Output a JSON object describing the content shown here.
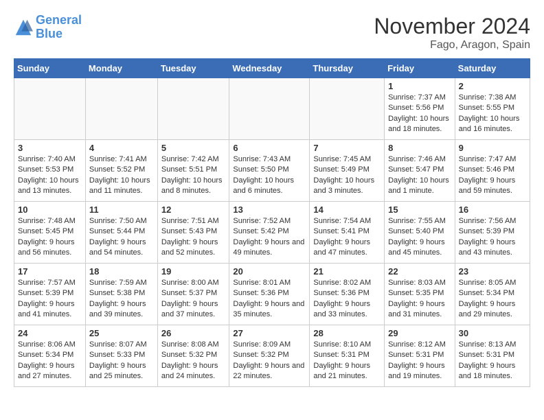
{
  "header": {
    "logo": {
      "line1": "General",
      "line2": "Blue"
    },
    "title": "November 2024",
    "location": "Fago, Aragon, Spain"
  },
  "weekdays": [
    "Sunday",
    "Monday",
    "Tuesday",
    "Wednesday",
    "Thursday",
    "Friday",
    "Saturday"
  ],
  "weeks": [
    [
      {
        "day": "",
        "empty": true
      },
      {
        "day": "",
        "empty": true
      },
      {
        "day": "",
        "empty": true
      },
      {
        "day": "",
        "empty": true
      },
      {
        "day": "",
        "empty": true
      },
      {
        "day": "1",
        "sunrise": "Sunrise: 7:37 AM",
        "sunset": "Sunset: 5:56 PM",
        "daylight": "Daylight: 10 hours and 18 minutes."
      },
      {
        "day": "2",
        "sunrise": "Sunrise: 7:38 AM",
        "sunset": "Sunset: 5:55 PM",
        "daylight": "Daylight: 10 hours and 16 minutes."
      }
    ],
    [
      {
        "day": "3",
        "sunrise": "Sunrise: 7:40 AM",
        "sunset": "Sunset: 5:53 PM",
        "daylight": "Daylight: 10 hours and 13 minutes."
      },
      {
        "day": "4",
        "sunrise": "Sunrise: 7:41 AM",
        "sunset": "Sunset: 5:52 PM",
        "daylight": "Daylight: 10 hours and 11 minutes."
      },
      {
        "day": "5",
        "sunrise": "Sunrise: 7:42 AM",
        "sunset": "Sunset: 5:51 PM",
        "daylight": "Daylight: 10 hours and 8 minutes."
      },
      {
        "day": "6",
        "sunrise": "Sunrise: 7:43 AM",
        "sunset": "Sunset: 5:50 PM",
        "daylight": "Daylight: 10 hours and 6 minutes."
      },
      {
        "day": "7",
        "sunrise": "Sunrise: 7:45 AM",
        "sunset": "Sunset: 5:49 PM",
        "daylight": "Daylight: 10 hours and 3 minutes."
      },
      {
        "day": "8",
        "sunrise": "Sunrise: 7:46 AM",
        "sunset": "Sunset: 5:47 PM",
        "daylight": "Daylight: 10 hours and 1 minute."
      },
      {
        "day": "9",
        "sunrise": "Sunrise: 7:47 AM",
        "sunset": "Sunset: 5:46 PM",
        "daylight": "Daylight: 9 hours and 59 minutes."
      }
    ],
    [
      {
        "day": "10",
        "sunrise": "Sunrise: 7:48 AM",
        "sunset": "Sunset: 5:45 PM",
        "daylight": "Daylight: 9 hours and 56 minutes."
      },
      {
        "day": "11",
        "sunrise": "Sunrise: 7:50 AM",
        "sunset": "Sunset: 5:44 PM",
        "daylight": "Daylight: 9 hours and 54 minutes."
      },
      {
        "day": "12",
        "sunrise": "Sunrise: 7:51 AM",
        "sunset": "Sunset: 5:43 PM",
        "daylight": "Daylight: 9 hours and 52 minutes."
      },
      {
        "day": "13",
        "sunrise": "Sunrise: 7:52 AM",
        "sunset": "Sunset: 5:42 PM",
        "daylight": "Daylight: 9 hours and 49 minutes."
      },
      {
        "day": "14",
        "sunrise": "Sunrise: 7:54 AM",
        "sunset": "Sunset: 5:41 PM",
        "daylight": "Daylight: 9 hours and 47 minutes."
      },
      {
        "day": "15",
        "sunrise": "Sunrise: 7:55 AM",
        "sunset": "Sunset: 5:40 PM",
        "daylight": "Daylight: 9 hours and 45 minutes."
      },
      {
        "day": "16",
        "sunrise": "Sunrise: 7:56 AM",
        "sunset": "Sunset: 5:39 PM",
        "daylight": "Daylight: 9 hours and 43 minutes."
      }
    ],
    [
      {
        "day": "17",
        "sunrise": "Sunrise: 7:57 AM",
        "sunset": "Sunset: 5:39 PM",
        "daylight": "Daylight: 9 hours and 41 minutes."
      },
      {
        "day": "18",
        "sunrise": "Sunrise: 7:59 AM",
        "sunset": "Sunset: 5:38 PM",
        "daylight": "Daylight: 9 hours and 39 minutes."
      },
      {
        "day": "19",
        "sunrise": "Sunrise: 8:00 AM",
        "sunset": "Sunset: 5:37 PM",
        "daylight": "Daylight: 9 hours and 37 minutes."
      },
      {
        "day": "20",
        "sunrise": "Sunrise: 8:01 AM",
        "sunset": "Sunset: 5:36 PM",
        "daylight": "Daylight: 9 hours and 35 minutes."
      },
      {
        "day": "21",
        "sunrise": "Sunrise: 8:02 AM",
        "sunset": "Sunset: 5:36 PM",
        "daylight": "Daylight: 9 hours and 33 minutes."
      },
      {
        "day": "22",
        "sunrise": "Sunrise: 8:03 AM",
        "sunset": "Sunset: 5:35 PM",
        "daylight": "Daylight: 9 hours and 31 minutes."
      },
      {
        "day": "23",
        "sunrise": "Sunrise: 8:05 AM",
        "sunset": "Sunset: 5:34 PM",
        "daylight": "Daylight: 9 hours and 29 minutes."
      }
    ],
    [
      {
        "day": "24",
        "sunrise": "Sunrise: 8:06 AM",
        "sunset": "Sunset: 5:34 PM",
        "daylight": "Daylight: 9 hours and 27 minutes."
      },
      {
        "day": "25",
        "sunrise": "Sunrise: 8:07 AM",
        "sunset": "Sunset: 5:33 PM",
        "daylight": "Daylight: 9 hours and 25 minutes."
      },
      {
        "day": "26",
        "sunrise": "Sunrise: 8:08 AM",
        "sunset": "Sunset: 5:32 PM",
        "daylight": "Daylight: 9 hours and 24 minutes."
      },
      {
        "day": "27",
        "sunrise": "Sunrise: 8:09 AM",
        "sunset": "Sunset: 5:32 PM",
        "daylight": "Daylight: 9 hours and 22 minutes."
      },
      {
        "day": "28",
        "sunrise": "Sunrise: 8:10 AM",
        "sunset": "Sunset: 5:31 PM",
        "daylight": "Daylight: 9 hours and 21 minutes."
      },
      {
        "day": "29",
        "sunrise": "Sunrise: 8:12 AM",
        "sunset": "Sunset: 5:31 PM",
        "daylight": "Daylight: 9 hours and 19 minutes."
      },
      {
        "day": "30",
        "sunrise": "Sunrise: 8:13 AM",
        "sunset": "Sunset: 5:31 PM",
        "daylight": "Daylight: 9 hours and 18 minutes."
      }
    ]
  ]
}
